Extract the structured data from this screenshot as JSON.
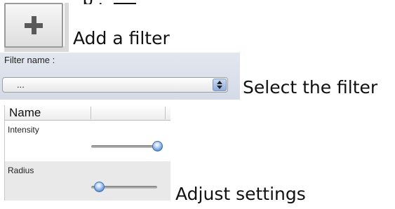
{
  "top_strip": {
    "text": "                 p                       ,   "
  },
  "add_filter": {
    "button_icon": "plus-icon",
    "label": "Add a filter"
  },
  "filter": {
    "name_label": "Filter name :",
    "select_value": "...",
    "select_icon": "updown-arrows-icon",
    "caption": "Select the filter"
  },
  "settings": {
    "column_header": "Name",
    "rows": [
      {
        "label": "Intensity",
        "slider_value": 1.0
      },
      {
        "label": "Radius",
        "slider_value": 0.12
      }
    ],
    "caption": "Adjust settings"
  }
}
